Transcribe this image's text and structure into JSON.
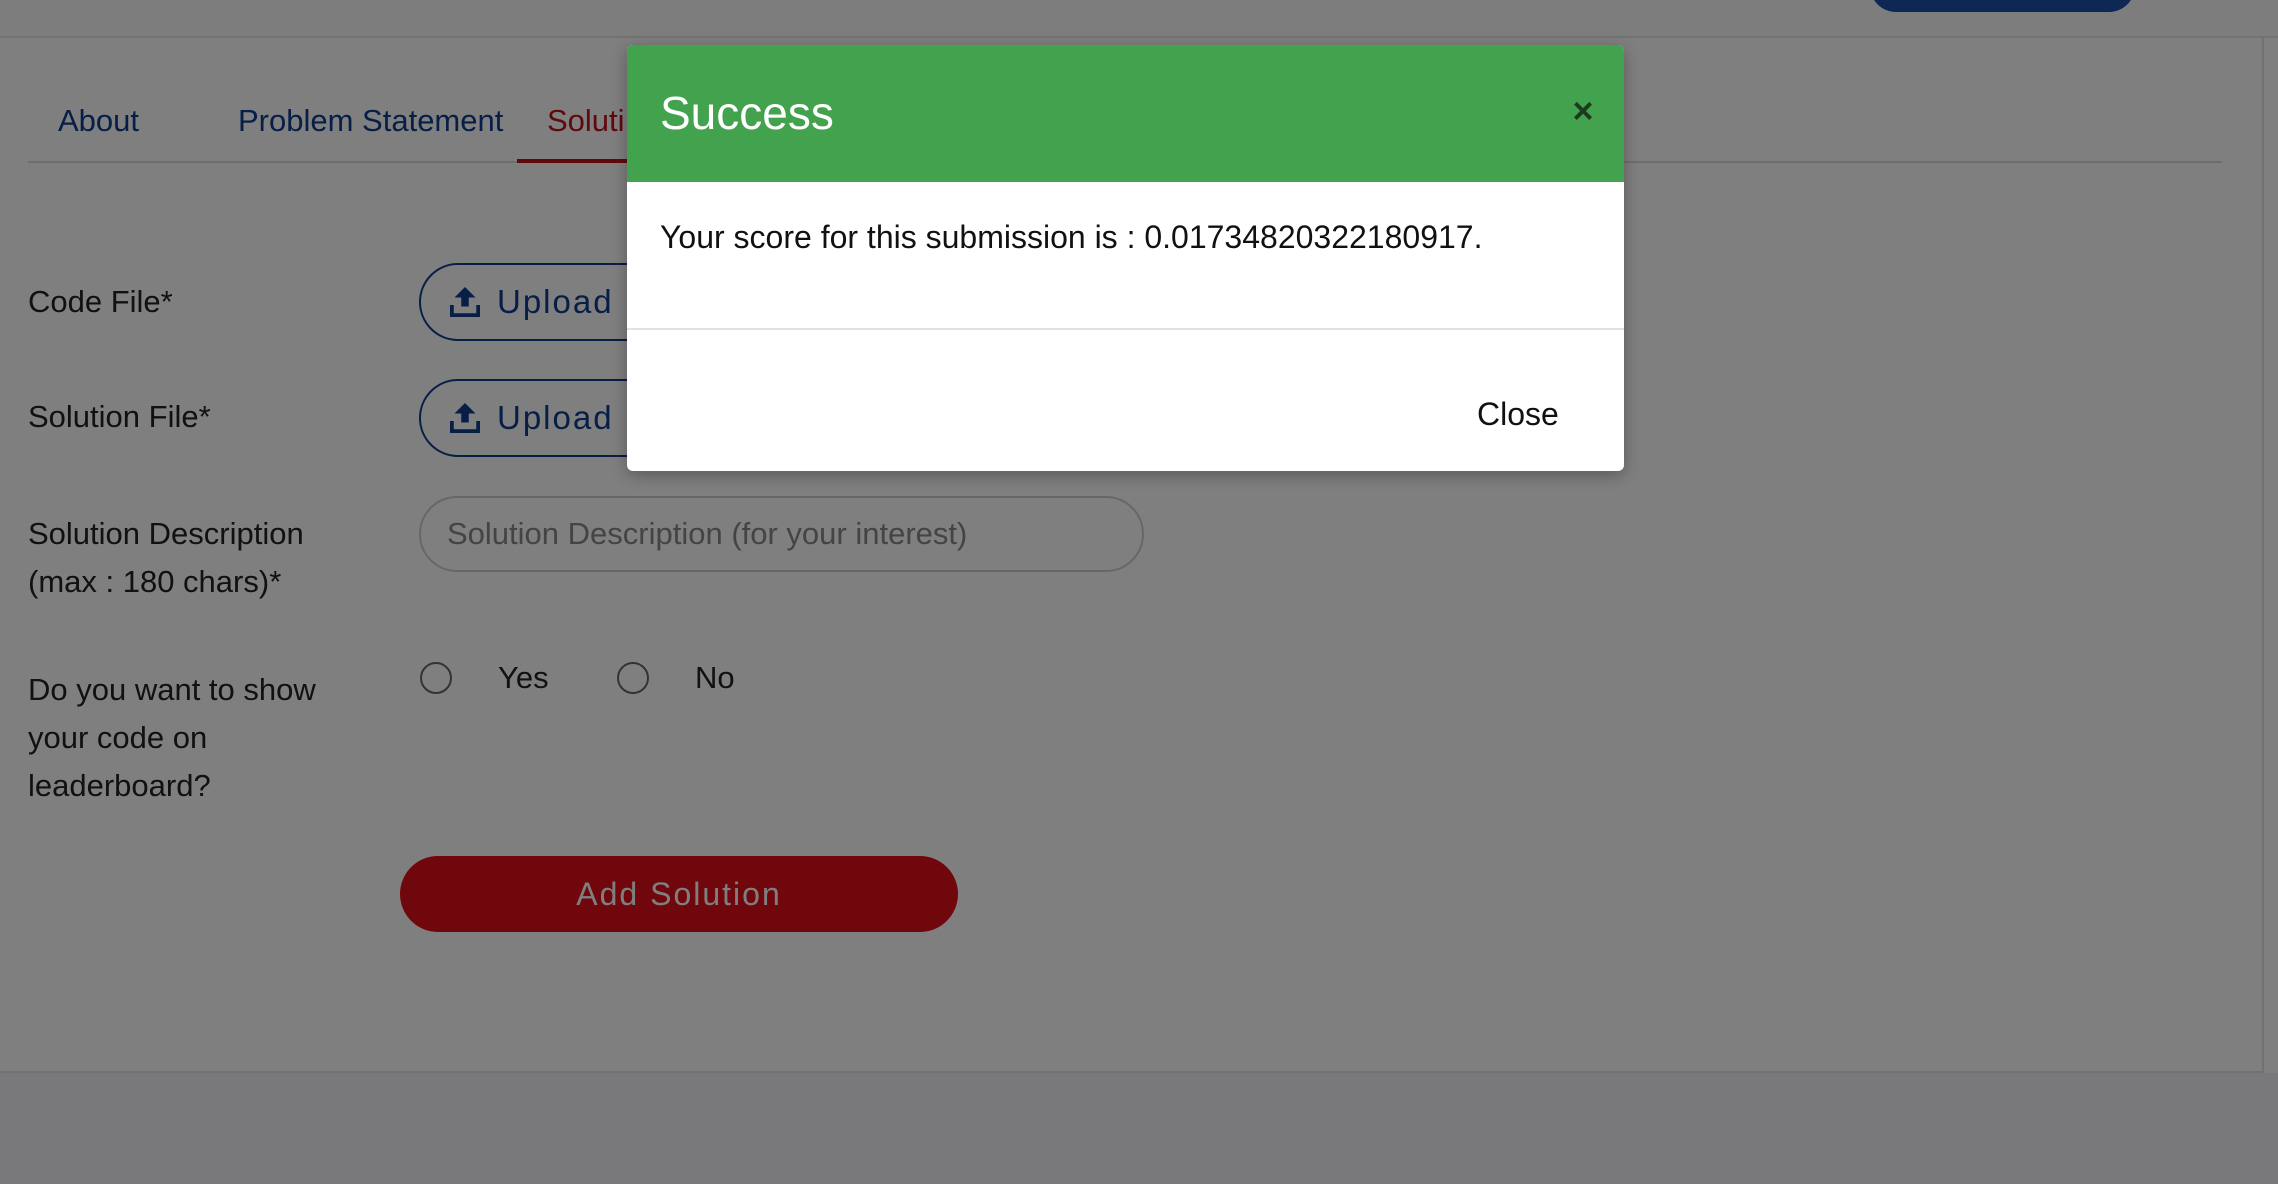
{
  "tabs": [
    {
      "label": "About"
    },
    {
      "label": "Problem Statement"
    },
    {
      "label": "Soluti"
    }
  ],
  "form": {
    "code_file_label": "Code File*",
    "solution_file_label": "Solution File*",
    "upload_label": "Upload F",
    "description_label_line1": "Solution Description",
    "description_label_line2": "(max : 180 chars)*",
    "description_placeholder": "Solution Description (for your interest)",
    "show_code_label_line1": "Do you want to show",
    "show_code_label_line2": "your code on",
    "show_code_label_line3": "leaderboard?",
    "yes_label": "Yes",
    "no_label": "No",
    "submit_label": "Add Solution"
  },
  "modal": {
    "title": "Success",
    "close_x": "×",
    "message": "Your score for this submission is : 0.01734820322180917.",
    "close_label": "Close"
  },
  "colors": {
    "primary": "#0f3d8c",
    "accent": "#e10e19",
    "success": "#43a24e"
  },
  "icons": {
    "upload": "upload-icon",
    "close": "close-icon"
  }
}
